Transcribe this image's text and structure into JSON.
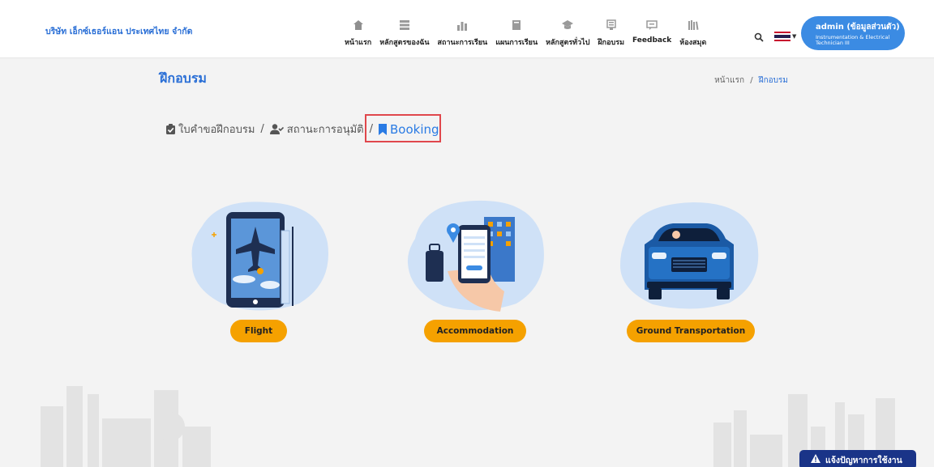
{
  "header": {
    "company": "บริษัท เอ็กซ์เธอร์แอน ประเทศไทย จำกัด",
    "nav": [
      {
        "label": "หน้าแรก",
        "icon": "home-icon"
      },
      {
        "label": "หลักสูตรของฉัน",
        "icon": "list-icon"
      },
      {
        "label": "สถานะการเรียน",
        "icon": "stats-icon"
      },
      {
        "label": "แผนการเรียน",
        "icon": "book-icon"
      },
      {
        "label": "หลักสูตรทั่วไป",
        "icon": "graduation-cap-icon"
      },
      {
        "label": "ฝึกอบรม",
        "icon": "training-icon"
      },
      {
        "label": "Feedback",
        "icon": "feedback-icon"
      },
      {
        "label": "ห้องสมุด",
        "icon": "library-icon"
      }
    ],
    "user": {
      "name": "admin (ข้อมูลส่วนตัว)",
      "role": "Instrumentation & Electrical Technician III"
    }
  },
  "page": {
    "title": "ฝึกอบรม",
    "breadcrumb": {
      "home": "หน้าแรก",
      "sep": "/",
      "current": "ฝึกอบรม"
    }
  },
  "steps": [
    {
      "label": "ใบคำขอฝึกอบรม",
      "icon": "clipboard-check-icon"
    },
    {
      "label": "สถานะการอนุมัติ",
      "icon": "user-check-icon"
    },
    {
      "label": "Booking",
      "icon": "bookmark-icon"
    }
  ],
  "steps_sep": "/",
  "cards": [
    {
      "label": "Flight",
      "icon": "flight-illustration"
    },
    {
      "label": "Accommodation",
      "icon": "accommodation-illustration"
    },
    {
      "label": "Ground Transportation",
      "icon": "car-illustration"
    }
  ],
  "report_button": "แจ้งปัญหาการใช้งาน",
  "colors": {
    "brand_blue": "#2a6fd6",
    "user_button": "#3b8be3",
    "pill_orange": "#f5a100",
    "highlight_red": "#e0474c",
    "report_button": "#1a3488"
  }
}
